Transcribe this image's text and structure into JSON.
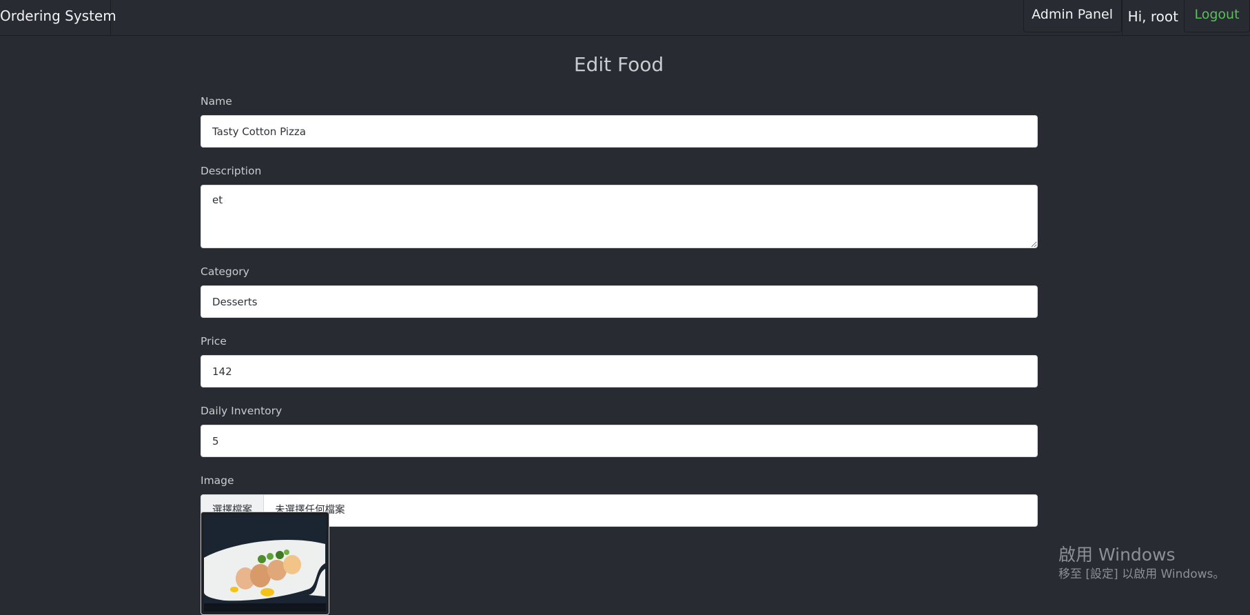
{
  "navbar": {
    "brand": "Ordering System",
    "admin_panel": "Admin Panel",
    "greeting": "Hi, root",
    "logout": "Logout"
  },
  "page": {
    "title": "Edit Food"
  },
  "form": {
    "name": {
      "label": "Name",
      "value": "Tasty Cotton Pizza"
    },
    "description": {
      "label": "Description",
      "value": "et"
    },
    "category": {
      "label": "Category",
      "value": "Desserts"
    },
    "price": {
      "label": "Price",
      "value": "142"
    },
    "inventory": {
      "label": "Daily Inventory",
      "value": "5"
    },
    "image": {
      "label": "Image",
      "button": "選擇檔案",
      "status": "未選擇任何檔案"
    }
  },
  "watermark": {
    "title": "啟用 Windows",
    "subtitle": "移至 [設定] 以啟用 Windows。"
  },
  "colors": {
    "background": "#282b31",
    "accent_logout": "#5cc05a"
  }
}
